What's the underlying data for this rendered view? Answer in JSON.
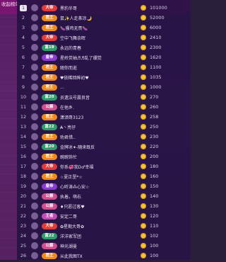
{
  "side": {
    "collapse": "收起榜单"
  },
  "rows": [
    {
      "rank": "1",
      "name": "黑豹半哥",
      "score": "101000",
      "badge": "大帝",
      "color": "#e23a3a"
    },
    {
      "rank": "2",
      "name": "鼠✨人走茶凉🌙",
      "score": "52000",
      "badge": "君王",
      "color": "#f18a1c"
    },
    {
      "rank": "3",
      "name": "🍆骚鸡无畏🍆",
      "score": "6000",
      "badge": "君王",
      "color": "#f18a1c"
    },
    {
      "rank": "4",
      "name": "空中飞舞余晖",
      "score": "2410",
      "badge": "大帝",
      "color": "#e23a3a"
    },
    {
      "rank": "5",
      "name": "永远的青春",
      "score": "2300",
      "badge": "富19",
      "color": "#2f9e6a"
    },
    {
      "rank": "6",
      "name": "星岭荧袖♬♬乱了绷觉",
      "score": "1620",
      "badge": "皇帝",
      "color": "#8b3bd1"
    },
    {
      "rank": "7",
      "name": "随你而逝",
      "score": "1100",
      "badge": "君王",
      "color": "#f18a1c"
    },
    {
      "rank": "8",
      "name": "♥依稀回眸初♥",
      "score": "1035",
      "badge": "君王",
      "color": "#f18a1c"
    },
    {
      "rank": "9",
      "name": "...",
      "score": "1000",
      "badge": "君王",
      "color": "#f18a1c"
    },
    {
      "rank": "10",
      "name": "员遗法号震良音",
      "score": "270",
      "badge": "富20",
      "color": "#2f9e6a"
    },
    {
      "rank": "11",
      "name": "在他乡.",
      "score": "260",
      "badge": "公爵",
      "color": "#d14f8f"
    },
    {
      "rank": "12",
      "name": "潇洒哥3123",
      "score": "258",
      "badge": "君王",
      "color": "#f18a1c"
    },
    {
      "rank": "13",
      "name": "A̶丶亮仔",
      "score": "250",
      "badge": "富22",
      "color": "#2f9e6a"
    },
    {
      "rank": "14",
      "name": "劝君惜..",
      "score": "230",
      "badge": "君王",
      "color": "#f18a1c"
    },
    {
      "rank": "15",
      "name": "金牌冰✦-随来既反",
      "score": "220",
      "badge": "富20",
      "color": "#2f9e6a"
    },
    {
      "rank": "16",
      "name": "豌豌饰忙",
      "score": "200",
      "badge": "君王",
      "color": "#f18a1c"
    },
    {
      "rank": "17",
      "name": "你系💞我D♂幸福",
      "score": "180",
      "badge": "大帝",
      "color": "#e23a3a"
    },
    {
      "rank": "18",
      "name": "☆夏正罡*☆",
      "score": "160",
      "badge": "君王",
      "color": "#f18a1c"
    },
    {
      "rank": "19",
      "name": "心听涛⁂心安☆",
      "score": "150",
      "badge": "皇帝",
      "color": "#8b3bd1"
    },
    {
      "rank": "20",
      "name": "执着。萌右",
      "score": "140",
      "badge": "公爵",
      "color": "#d14f8f"
    },
    {
      "rank": "21",
      "name": "♦只愿过客♥",
      "score": "130",
      "badge": "公爵",
      "color": "#d14f8f"
    },
    {
      "rank": "22",
      "name": "安定二哥",
      "score": "120",
      "badge": "王者",
      "color": "#c24bb5"
    },
    {
      "rank": "23",
      "name": "✿星期大哥✿",
      "score": "110",
      "badge": "大帝",
      "color": "#e23a3a"
    },
    {
      "rank": "24",
      "name": "洋洋家军团",
      "score": "102",
      "badge": "富22",
      "color": "#2f9e6a"
    },
    {
      "rank": "25",
      "name": "神光湖曼",
      "score": "100",
      "badge": "公爵",
      "color": "#d14f8f"
    },
    {
      "rank": "26",
      "name": "从此我图TX",
      "score": "100",
      "badge": "君王",
      "color": "#f18a1c"
    }
  ]
}
